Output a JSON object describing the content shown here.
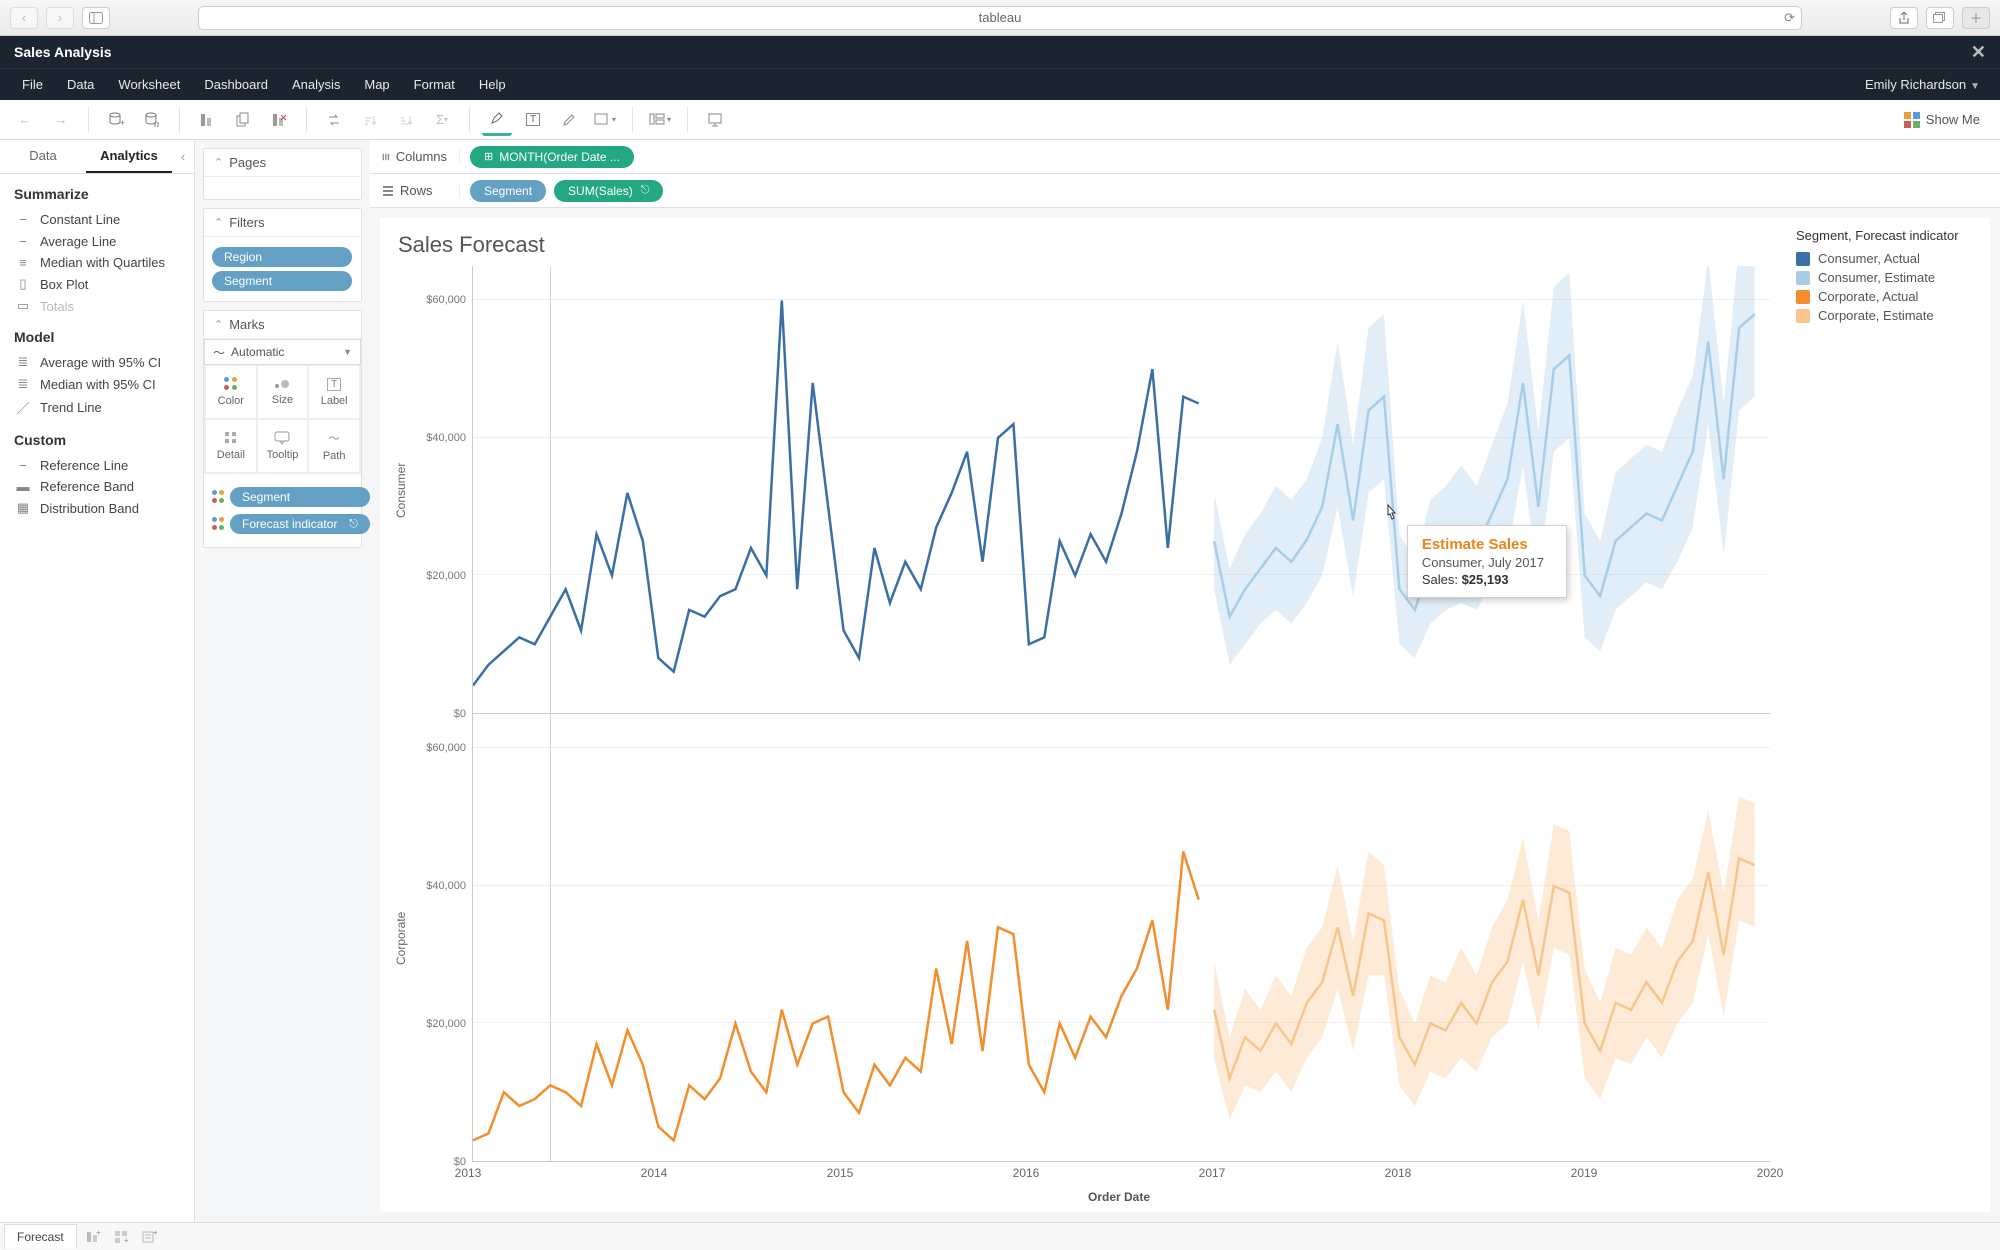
{
  "browser": {
    "url": "tableau"
  },
  "app": {
    "title": "Sales Analysis",
    "user": "Emily Richardson"
  },
  "menu": [
    "File",
    "Data",
    "Worksheet",
    "Dashboard",
    "Analysis",
    "Map",
    "Format",
    "Help"
  ],
  "showme": "Show Me",
  "leftTabs": {
    "data": "Data",
    "analytics": "Analytics"
  },
  "analytics": {
    "summarize": {
      "head": "Summarize",
      "items": [
        "Constant Line",
        "Average Line",
        "Median with Quartiles",
        "Box Plot",
        "Totals"
      ]
    },
    "model": {
      "head": "Model",
      "items": [
        "Average with 95% CI",
        "Median with 95% CI",
        "Trend Line"
      ]
    },
    "custom": {
      "head": "Custom",
      "items": [
        "Reference Line",
        "Reference Band",
        "Distribution Band"
      ]
    }
  },
  "cards": {
    "pages": "Pages",
    "filters": {
      "head": "Filters",
      "pills": [
        "Region",
        "Segment"
      ]
    },
    "marks": {
      "head": "Marks",
      "type": "Automatic",
      "cells": [
        "Color",
        "Size",
        "Label",
        "Detail",
        "Tooltip",
        "Path"
      ],
      "encodings": [
        "Segment",
        "Forecast indicator"
      ]
    }
  },
  "shelves": {
    "columns": {
      "label": "Columns",
      "pill": "MONTH(Order Date ..."
    },
    "rows": {
      "label": "Rows",
      "pills": [
        "Segment",
        "SUM(Sales)"
      ]
    }
  },
  "viz": {
    "title": "Sales Forecast",
    "xTitle": "Order Date",
    "xTicks": [
      "2013",
      "2014",
      "2015",
      "2016",
      "2017",
      "2018",
      "2019",
      "2020"
    ],
    "yTicks": [
      "$0",
      "$20,000",
      "$40,000",
      "$60,000"
    ],
    "panels": [
      "Consumer",
      "Corporate"
    ],
    "legend": {
      "title": "Segment, Forecast indicator",
      "items": [
        {
          "label": "Consumer, Actual",
          "color": "#3a6fa5"
        },
        {
          "label": "Consumer, Estimate",
          "color": "#a8cde8"
        },
        {
          "label": "Corporate, Actual",
          "color": "#f28e2b"
        },
        {
          "label": "Corporate, Estimate",
          "color": "#f8c58d"
        }
      ]
    },
    "tooltip": {
      "title": "Estimate Sales",
      "sub": "Consumer, July 2017",
      "saleslabel": "Sales:",
      "sales": "$25,193"
    }
  },
  "footer": {
    "sheet": "Forecast"
  },
  "chart_data": [
    {
      "type": "line",
      "segment": "Consumer",
      "xlabel": "Order Date",
      "ylabel": "SUM(Sales)",
      "ylim": [
        0,
        65000
      ],
      "x_range": [
        "2013-01",
        "2020-01"
      ],
      "series": [
        {
          "name": "Consumer, Actual",
          "color": "#3a6fa5",
          "x_start": "2013-01",
          "values": [
            4000,
            7000,
            9000,
            11000,
            10000,
            14000,
            18000,
            12000,
            26000,
            20000,
            32000,
            25000,
            8000,
            6000,
            15000,
            14000,
            17000,
            18000,
            24000,
            20000,
            60000,
            18000,
            48000,
            30000,
            12000,
            8000,
            24000,
            16000,
            22000,
            18000,
            27000,
            32000,
            38000,
            22000,
            40000,
            42000,
            10000,
            11000,
            25000,
            20000,
            26000,
            22000,
            29000,
            38000,
            50000,
            24000,
            46000,
            45000
          ]
        },
        {
          "name": "Consumer, Estimate",
          "color": "#a8cde8",
          "x_start": "2017-01",
          "values": [
            25000,
            14000,
            18000,
            21000,
            24000,
            22000,
            25193,
            30000,
            42000,
            28000,
            44000,
            46000,
            18000,
            15000,
            22000,
            24000,
            26000,
            24000,
            29000,
            34000,
            48000,
            30000,
            50000,
            52000,
            20000,
            17000,
            25000,
            27000,
            29000,
            28000,
            33000,
            38000,
            54000,
            34000,
            56000,
            58000
          ],
          "lower": [
            18000,
            7000,
            10000,
            13000,
            15000,
            13000,
            16000,
            20000,
            30000,
            17000,
            32000,
            34000,
            10000,
            8000,
            13000,
            15000,
            16000,
            15000,
            19000,
            23000,
            36000,
            19000,
            38000,
            40000,
            11000,
            9000,
            15000,
            17000,
            19000,
            18000,
            22000,
            27000,
            42000,
            23000,
            44000,
            46000
          ],
          "upper": [
            32000,
            21000,
            26000,
            29000,
            33000,
            31000,
            34000,
            40000,
            54000,
            39000,
            56000,
            58000,
            26000,
            22000,
            31000,
            33000,
            36000,
            33000,
            39000,
            45000,
            60000,
            41000,
            62000,
            64000,
            29000,
            25000,
            35000,
            37000,
            39000,
            38000,
            44000,
            49000,
            66000,
            45000,
            68000,
            70000
          ]
        }
      ]
    },
    {
      "type": "line",
      "segment": "Corporate",
      "xlabel": "Order Date",
      "ylabel": "SUM(Sales)",
      "ylim": [
        0,
        65000
      ],
      "x_range": [
        "2013-01",
        "2020-01"
      ],
      "series": [
        {
          "name": "Corporate, Actual",
          "color": "#f28e2b",
          "x_start": "2013-01",
          "values": [
            3000,
            4000,
            10000,
            8000,
            9000,
            11000,
            10000,
            8000,
            17000,
            11000,
            19000,
            14000,
            5000,
            3000,
            11000,
            9000,
            12000,
            20000,
            13000,
            10000,
            22000,
            14000,
            20000,
            21000,
            10000,
            7000,
            14000,
            11000,
            15000,
            13000,
            28000,
            17000,
            32000,
            16000,
            34000,
            33000,
            14000,
            10000,
            20000,
            15000,
            21000,
            18000,
            24000,
            28000,
            35000,
            22000,
            45000,
            38000
          ]
        },
        {
          "name": "Corporate, Estimate",
          "color": "#f8c58d",
          "x_start": "2017-01",
          "values": [
            22000,
            12000,
            18000,
            16000,
            20000,
            17000,
            23000,
            26000,
            34000,
            24000,
            36000,
            35000,
            18000,
            14000,
            20000,
            19000,
            23000,
            20000,
            26000,
            29000,
            38000,
            27000,
            40000,
            39000,
            20000,
            16000,
            23000,
            22000,
            26000,
            23000,
            29000,
            32000,
            42000,
            30000,
            44000,
            43000
          ],
          "lower": [
            15000,
            6000,
            11000,
            10000,
            13000,
            10000,
            15000,
            18000,
            25000,
            16000,
            27000,
            27000,
            11000,
            8000,
            13000,
            12000,
            15000,
            13000,
            18000,
            20000,
            29000,
            19000,
            31000,
            30000,
            12000,
            9000,
            15000,
            14000,
            18000,
            15000,
            20000,
            23000,
            33000,
            21000,
            35000,
            34000
          ],
          "upper": [
            29000,
            18000,
            25000,
            22000,
            27000,
            24000,
            31000,
            34000,
            43000,
            32000,
            45000,
            43000,
            25000,
            20000,
            27000,
            26000,
            31000,
            27000,
            34000,
            38000,
            47000,
            35000,
            49000,
            48000,
            28000,
            23000,
            31000,
            30000,
            34000,
            31000,
            38000,
            41000,
            51000,
            39000,
            53000,
            52000
          ]
        }
      ]
    }
  ]
}
